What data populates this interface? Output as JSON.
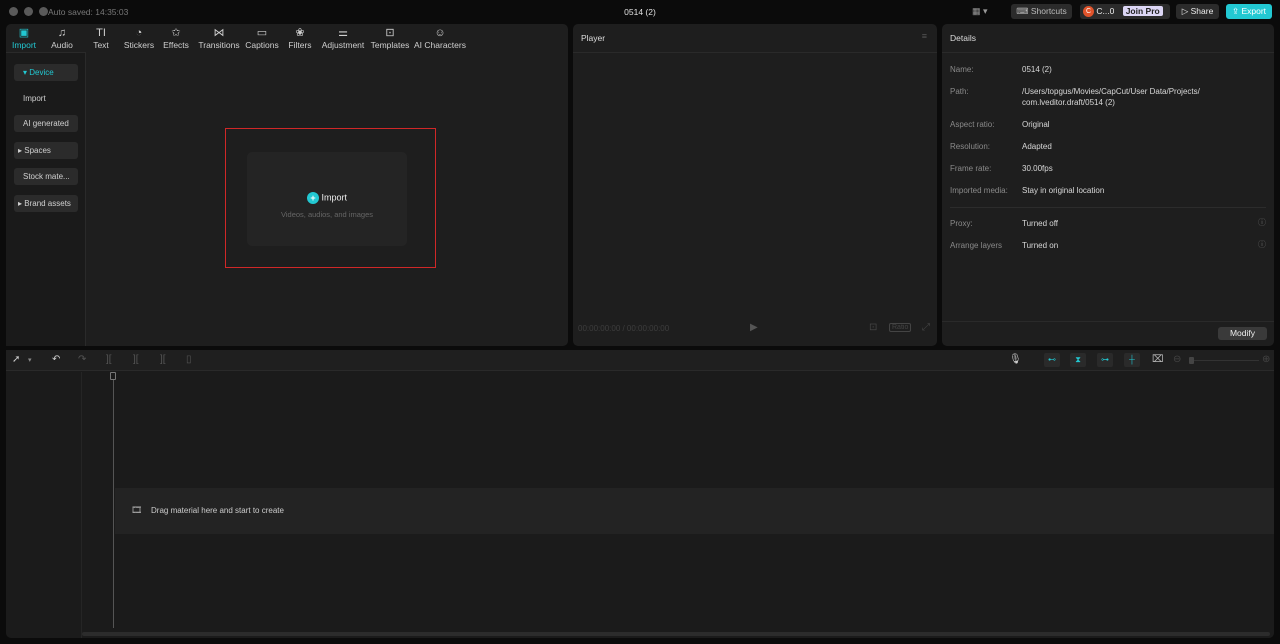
{
  "titlebar": {
    "auto_saved": "Auto saved: 14:35:03",
    "title": "0514 (2)",
    "shortcuts": "Shortcuts",
    "user": "C...0",
    "user_initial": "C",
    "join_pro": "Join Pro",
    "share": "Share",
    "export": "Export"
  },
  "tabs": [
    {
      "label": "Import",
      "icon": "import-icon"
    },
    {
      "label": "Audio",
      "icon": "audio-icon"
    },
    {
      "label": "Text",
      "icon": "text-icon"
    },
    {
      "label": "Stickers",
      "icon": "stickers-icon"
    },
    {
      "label": "Effects",
      "icon": "effects-icon"
    },
    {
      "label": "Transitions",
      "icon": "transitions-icon"
    },
    {
      "label": "Captions",
      "icon": "captions-icon"
    },
    {
      "label": "Filters",
      "icon": "filters-icon"
    },
    {
      "label": "Adjustment",
      "icon": "adjustment-icon"
    },
    {
      "label": "Templates",
      "icon": "templates-icon"
    },
    {
      "label": "AI Characters",
      "icon": "ai-characters-icon"
    }
  ],
  "sidebar": {
    "items": [
      {
        "label": "▾ Device"
      },
      {
        "label": "Import"
      },
      {
        "label": "AI generated"
      },
      {
        "label": "▸ Spaces"
      },
      {
        "label": "Stock mate..."
      },
      {
        "label": "▸ Brand assets"
      }
    ]
  },
  "import_card": {
    "title": "Import",
    "subtitle": "Videos, audios, and images"
  },
  "player": {
    "title": "Player",
    "time": "00:00:00:00 / 00:00:00:00",
    "ratio": "Ratio"
  },
  "details": {
    "title": "Details",
    "rows": [
      {
        "label": "Name:",
        "value": "0514 (2)"
      },
      {
        "label": "Path:",
        "value": "/Users/topgus/Movies/CapCut/User Data/Projects/",
        "value2": "com.lveditor.draft/0514 (2)"
      },
      {
        "label": "Aspect ratio:",
        "value": "Original"
      },
      {
        "label": "Resolution:",
        "value": "Adapted"
      },
      {
        "label": "Frame rate:",
        "value": "30.00fps"
      },
      {
        "label": "Imported media:",
        "value": "Stay in original location"
      },
      {
        "label": "Proxy:",
        "value": "Turned off"
      },
      {
        "label": "Arrange layers",
        "value": "Turned on"
      }
    ],
    "modify": "Modify"
  },
  "timeline": {
    "drop_hint": "Drag material here and start to create"
  },
  "colors": {
    "accent": "#22c8d2",
    "highlight": "#e03030"
  }
}
